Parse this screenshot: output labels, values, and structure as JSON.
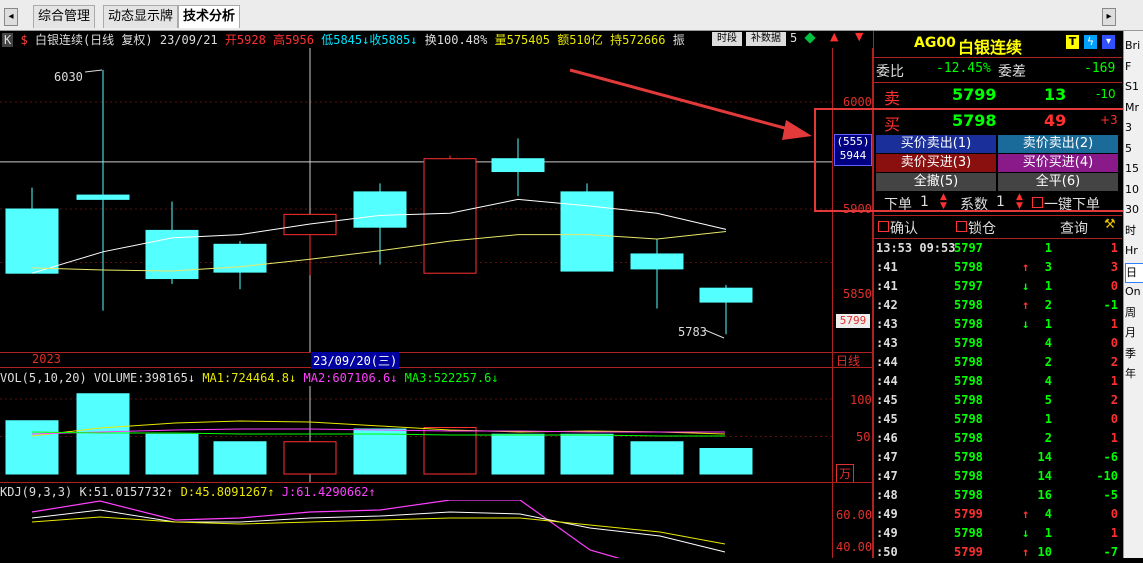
{
  "tabs": [
    {
      "label": "综合管理"
    },
    {
      "label": "动态显示牌"
    },
    {
      "label": "技术分析"
    }
  ],
  "info_bar": {
    "name": "白银连续(日线 复权)",
    "date": "23/09/21",
    "open_label": "开",
    "open": "5928",
    "high_label": "高",
    "high": "5956",
    "low_label": "低",
    "low": "5845",
    "close_label": "收",
    "close": "5885",
    "turnover_label": "换",
    "turnover": "100.48%",
    "volume_label": "量",
    "volume": "575405",
    "amount_label": "额",
    "amount": "510亿",
    "hold_label": "持",
    "hold": "572666",
    "amp_label": "振",
    "btn_time": "时段",
    "btn_fill": "补数据",
    "tail": "5"
  },
  "main_chart": {
    "price_ticks": [
      "6000",
      "5900",
      "5850"
    ],
    "high_label": "6030",
    "low_label": "5783",
    "crosshair_value_a": "(555)",
    "crosshair_value_b": "5944",
    "last_price": "5799",
    "year_label": "2023",
    "cursor_date": "23/09/20(三)",
    "period_label": "日线"
  },
  "chart_data": {
    "type": "candlestick",
    "candles": [
      {
        "open": 5900,
        "high": 5920,
        "low": 5840,
        "close": 5840
      },
      {
        "open": 5913,
        "high": 6030,
        "low": 5805,
        "close": 5909
      },
      {
        "open": 5880,
        "high": 5907,
        "low": 5830,
        "close": 5835
      },
      {
        "open": 5867,
        "high": 5870,
        "low": 5825,
        "close": 5841
      },
      {
        "open": 5876,
        "high": 5876,
        "low": 5838,
        "close": 5895
      },
      {
        "open": 5916,
        "high": 5924,
        "low": 5848,
        "close": 5883
      },
      {
        "open": 5840,
        "high": 5950,
        "low": 5840,
        "close": 5947
      },
      {
        "open": 5947,
        "high": 5966,
        "low": 5912,
        "close": 5935
      },
      {
        "open": 5916,
        "high": 5924,
        "low": 5842,
        "close": 5842
      },
      {
        "open": 5858,
        "high": 5872,
        "low": 5807,
        "close": 5844
      },
      {
        "open": 5826,
        "high": 5829,
        "low": 5783,
        "close": 5813
      }
    ],
    "ma_lines": [
      {
        "color": "#ffffff",
        "values": [
          5840,
          5860,
          5873,
          5876,
          5886,
          5894,
          5896,
          5909,
          5903,
          5896,
          5881
        ]
      },
      {
        "color": "#e8e86a",
        "values": [
          5845,
          5843,
          5842,
          5846,
          5853,
          5861,
          5870,
          5876,
          5876,
          5872,
          5879
        ]
      }
    ],
    "volumes": [
      71,
      107,
      53,
      43,
      43,
      60,
      62,
      53,
      53,
      43,
      34
    ],
    "volume_ticks": [
      "100",
      "50"
    ],
    "volume_unit": "万",
    "kdj_ticks": [
      "60.00",
      "40.00"
    ]
  },
  "volume_header": {
    "title": "VOL(5,10,20) VOLUME:",
    "volume": "398165",
    "ma1_label": "MA1:",
    "ma1": "724464.8",
    "ma2_label": "MA2:",
    "ma2": "607106.6",
    "ma3_label": "MA3:",
    "ma3": "522257.6"
  },
  "kdj_header": {
    "title": "KDJ(9,3,3) K:",
    "k": "51.0157732",
    "d_label": "D:",
    "d": "45.8091267",
    "j_label": "J:",
    "j": "61.4290662"
  },
  "right_panel": {
    "code": "AG00",
    "name": "白银连续",
    "ratio_label": "委比",
    "ratio": "-12.45%",
    "diff_label": "委差",
    "diff": "-169",
    "sell_label": "卖",
    "sell_price": "5799",
    "sell_vol": "13",
    "sell_chg": "-10",
    "buy_label": "买",
    "buy_price": "5798",
    "buy_vol": "49",
    "buy_chg": "+3",
    "btn1": "买价卖出(1)",
    "btn2": "卖价卖出(2)",
    "btn3": "卖价买进(3)",
    "btn4": "买价买进(4)",
    "btn5": "全撤(5)",
    "btn6": "全平(6)",
    "order_label": "下单",
    "order_qty": "1",
    "coef_label": "系数",
    "coef_qty": "1",
    "oneclick": "一键下单",
    "confirm": "确认",
    "lock": "锁仓",
    "query": "查询"
  },
  "ticks": [
    {
      "time": "13:53 09:53",
      "price": "5797",
      "arrow": "",
      "vol": "1",
      "chg": "1",
      "pc": "#00ff00"
    },
    {
      "time": ":41",
      "price": "5798",
      "arrow": "↑",
      "vol": "3",
      "chg": "3",
      "pc": "#00ff00"
    },
    {
      "time": ":41",
      "price": "5797",
      "arrow": "↓",
      "vol": "1",
      "chg": "0",
      "pc": "#00ff00"
    },
    {
      "time": ":42",
      "price": "5798",
      "arrow": "↑",
      "vol": "2",
      "chg": "-1",
      "pc": "#00ff00"
    },
    {
      "time": ":43",
      "price": "5798",
      "arrow": "↓",
      "vol": "1",
      "chg": "1",
      "pc": "#00ff00"
    },
    {
      "time": ":43",
      "price": "5798",
      "arrow": "",
      "vol": "4",
      "chg": "0",
      "pc": "#00ff00"
    },
    {
      "time": ":44",
      "price": "5798",
      "arrow": "",
      "vol": "2",
      "chg": "2",
      "pc": "#00ff00"
    },
    {
      "time": ":44",
      "price": "5798",
      "arrow": "",
      "vol": "4",
      "chg": "1",
      "pc": "#00ff00"
    },
    {
      "time": ":45",
      "price": "5798",
      "arrow": "",
      "vol": "5",
      "chg": "2",
      "pc": "#00ff00"
    },
    {
      "time": ":45",
      "price": "5798",
      "arrow": "",
      "vol": "1",
      "chg": "0",
      "pc": "#00ff00"
    },
    {
      "time": ":46",
      "price": "5798",
      "arrow": "",
      "vol": "2",
      "chg": "1",
      "pc": "#00ff00"
    },
    {
      "time": ":47",
      "price": "5798",
      "arrow": "",
      "vol": "14",
      "chg": "-6",
      "pc": "#00ff00"
    },
    {
      "time": ":47",
      "price": "5798",
      "arrow": "",
      "vol": "14",
      "chg": "-10",
      "pc": "#00ff00"
    },
    {
      "time": ":48",
      "price": "5798",
      "arrow": "",
      "vol": "16",
      "chg": "-5",
      "pc": "#00ff00"
    },
    {
      "time": ":49",
      "price": "5799",
      "arrow": "↑",
      "vol": "4",
      "chg": "0",
      "pc": "#ff3030"
    },
    {
      "time": ":49",
      "price": "5798",
      "arrow": "↓",
      "vol": "1",
      "chg": "1",
      "pc": "#00ff00"
    },
    {
      "time": ":50",
      "price": "5799",
      "arrow": "↑",
      "vol": "10",
      "chg": "-7",
      "pc": "#ff3030"
    }
  ],
  "side_toolbar": [
    "Bri",
    "F",
    "S1",
    "Mr",
    "3",
    "5",
    "15",
    "10",
    "30",
    "时",
    "Hr",
    "日",
    "On",
    "周",
    "月",
    "季",
    "年"
  ]
}
